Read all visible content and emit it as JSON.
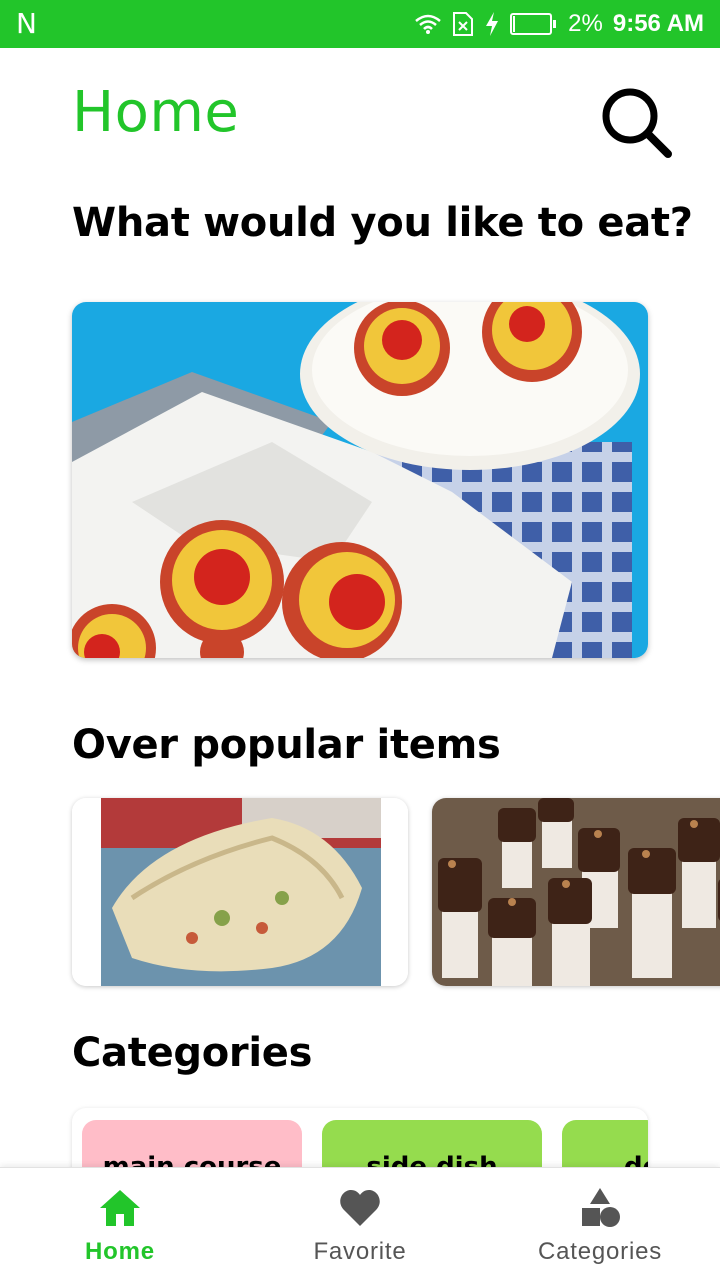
{
  "status_bar": {
    "carrier_glyph": "N",
    "battery_level": 0.02,
    "battery_text": "2%",
    "time": "9:56 AM"
  },
  "header": {
    "title": "Home",
    "subtitle": "What would you like to eat?"
  },
  "hero": {
    "description_icon": "mini-quiche-photo"
  },
  "popular": {
    "title": "Over popular items",
    "items": [
      {
        "icon": "savory-pie-photo"
      },
      {
        "icon": "chocolate-bites-photo"
      }
    ]
  },
  "categories": {
    "title": "Categories",
    "chips": [
      {
        "label": "main course",
        "color": "#ffbdc8"
      },
      {
        "label": "side dish",
        "color": "#95dc4e"
      },
      {
        "label": "de",
        "color": "#95dc4e"
      }
    ]
  },
  "bottom_nav": {
    "items": [
      {
        "label": "Home",
        "icon": "home-icon",
        "active": true
      },
      {
        "label": "Favorite",
        "icon": "heart-icon",
        "active": false
      },
      {
        "label": "Categories",
        "icon": "shapes-icon",
        "active": false
      }
    ],
    "active_color": "#22c52a",
    "inactive_color": "#555555"
  },
  "colors": {
    "accent": "#22c52a"
  }
}
